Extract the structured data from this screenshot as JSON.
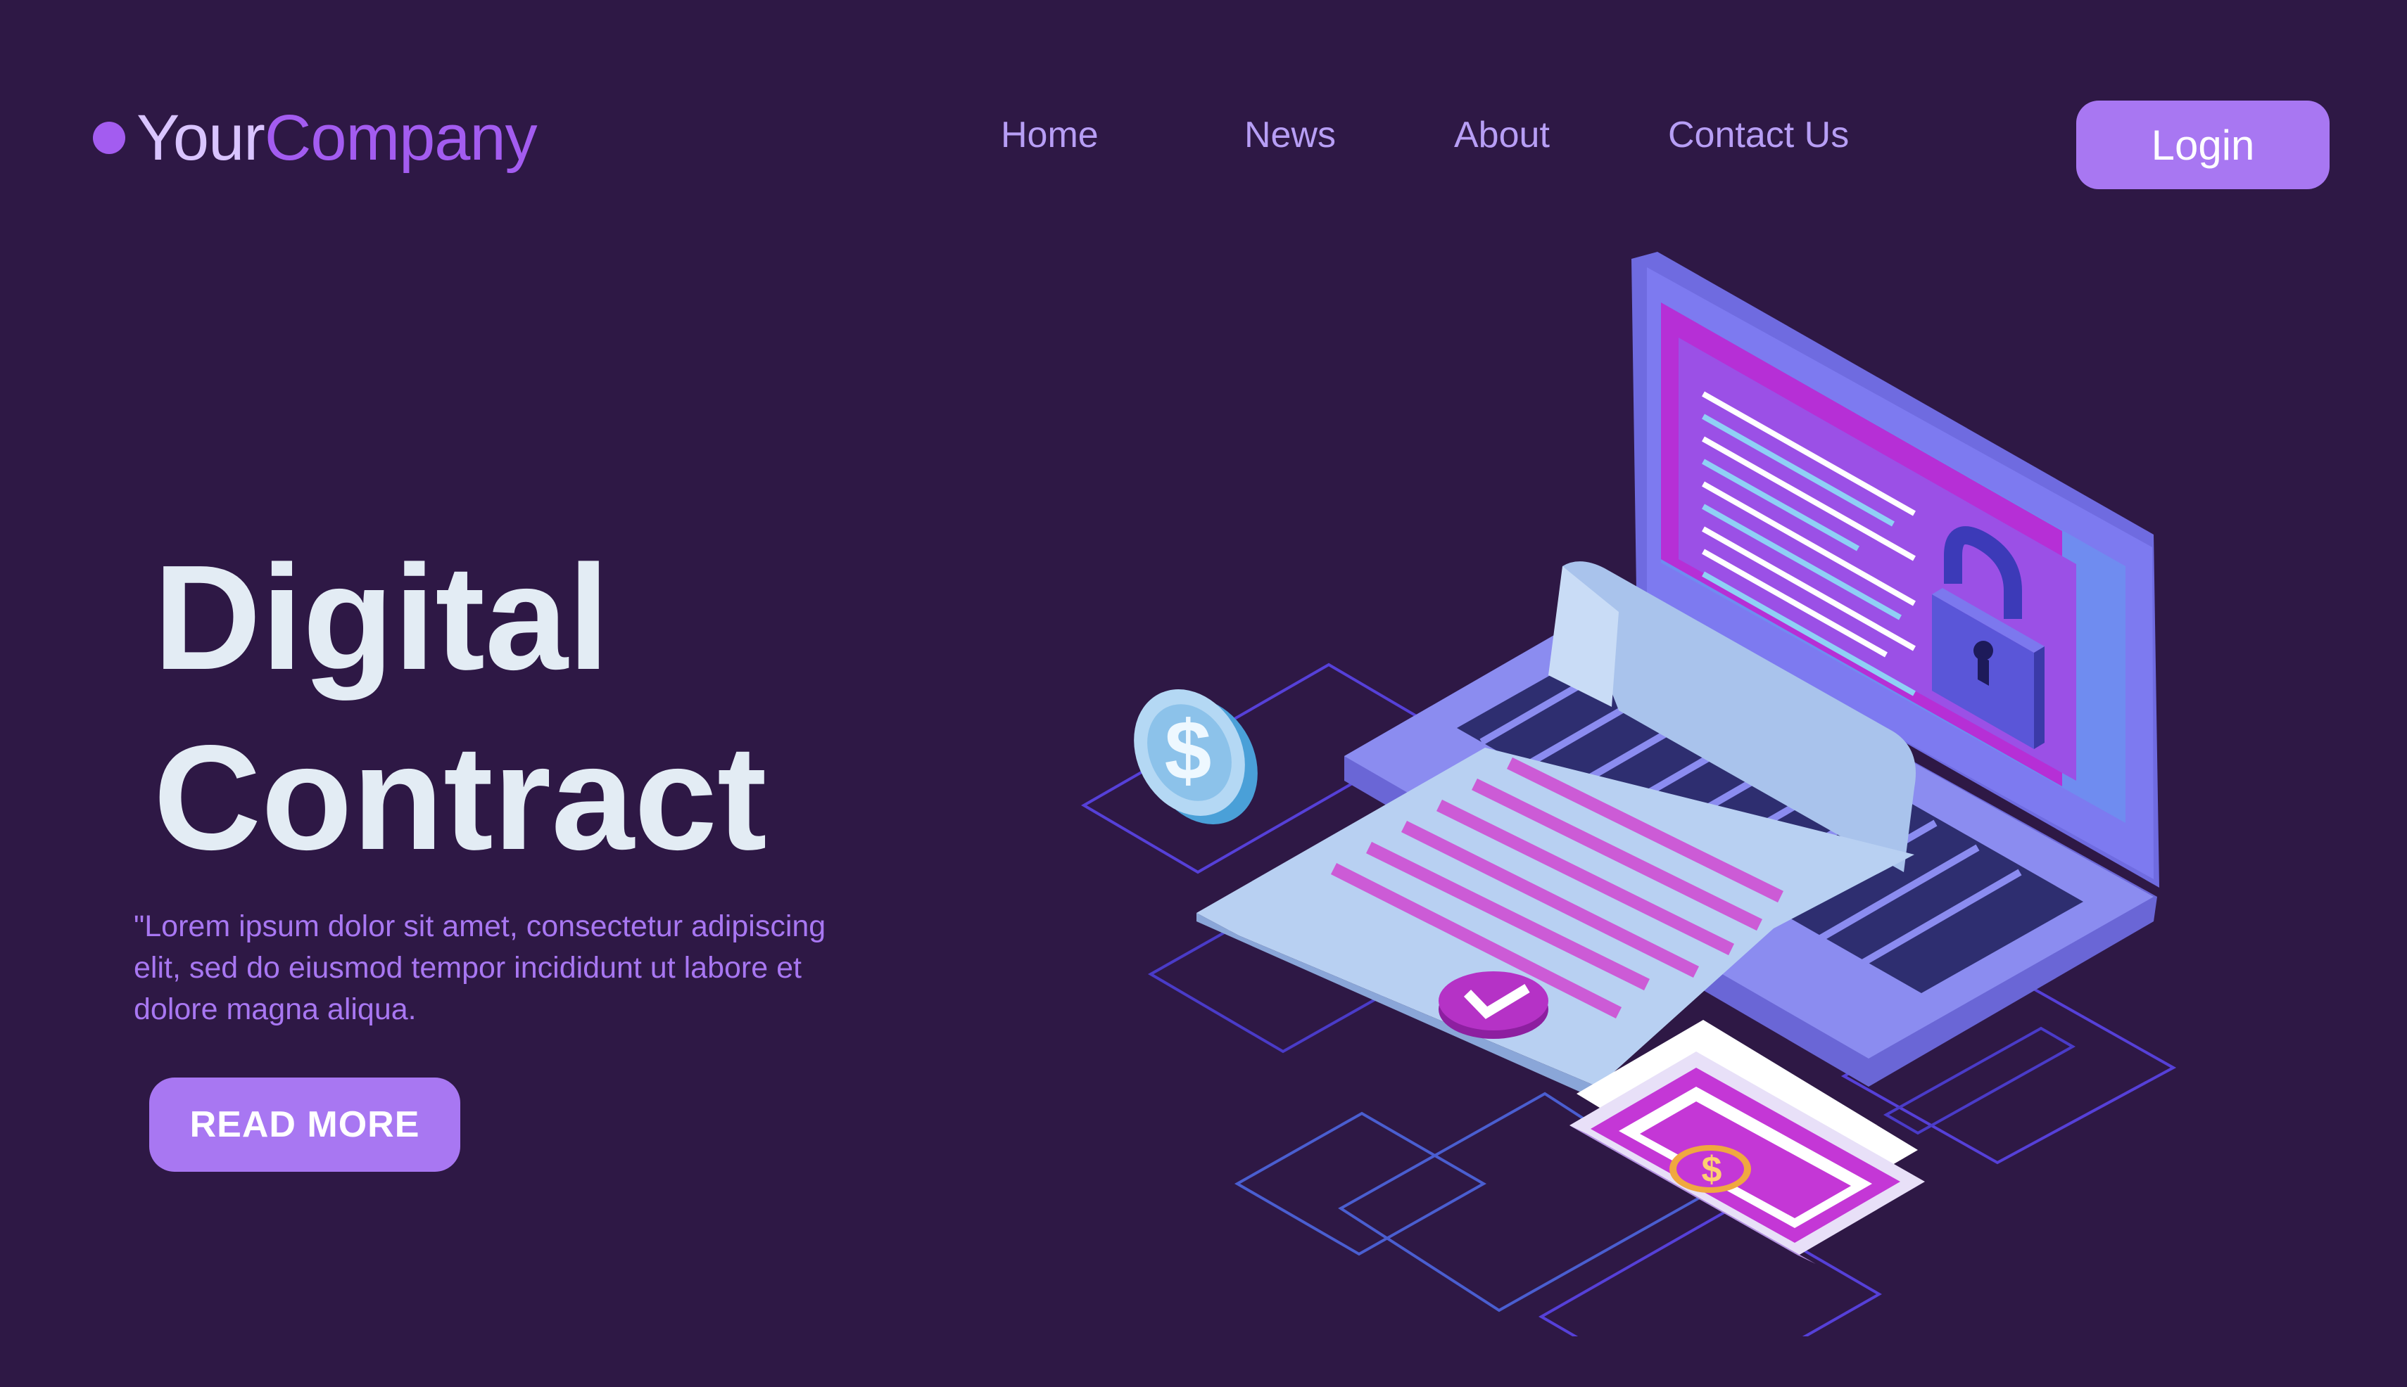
{
  "header": {
    "logo_part1": "Your",
    "logo_part2": "Company",
    "nav": [
      "Home",
      "News",
      "About",
      "Contact Us"
    ],
    "login_label": "Login"
  },
  "hero": {
    "title_line1": "Digital",
    "title_line2": "Contract",
    "description": "\"Lorem ipsum dolor sit amet, consectetur adipiscing elit, sed do eiusmod tempor incididunt ut labore et dolore magna aliqua.",
    "cta_label": "READ MORE"
  },
  "illustration": {
    "icons": [
      "laptop-icon",
      "padlock-icon",
      "contract-document-icon",
      "checkmark-badge-icon",
      "dollar-coin-icon",
      "dollar-bill-icon"
    ],
    "currency_symbol": "$"
  },
  "colors": {
    "background": "#2e1845",
    "accent": "#a877f2",
    "logo_purple": "#a35cf0",
    "title_text": "#e3ecf4",
    "nav_text": "#b79ef5"
  }
}
